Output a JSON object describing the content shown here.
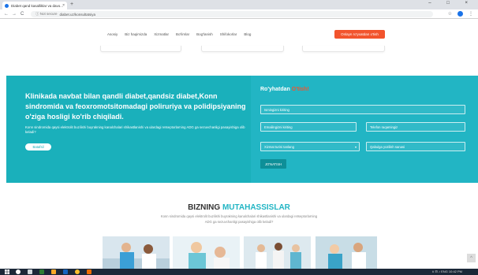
{
  "browser": {
    "tab_title": "Diabet qand kasalliklar va davo...",
    "tab_close": "×",
    "new_tab": "+",
    "window_controls": "– □ ×",
    "back": "←",
    "forward": "→",
    "reload": "C",
    "security": "ⓘ Not secure",
    "url": "diabet.uz/konsultatsiya",
    "toolbar_icons": [
      "☆",
      "⋮"
    ]
  },
  "nav": {
    "items": [
      "Asosiy",
      "Biz haqimizda",
      "Xizmatlar",
      "Bo'limlar",
      "Bog'lanish",
      "Shifokorlar",
      "Blog"
    ],
    "cta": "Onlayn ro'yxatdan o'tish"
  },
  "hero": {
    "title": "Klinikada navbat bilan qandli diabet,qandsiz diabet,Konn sindromida va feoxromotsitomadagi poliruriya va polidipsiyaning o'ziga hosligi ko'rib chiqiladi.",
    "subtitle": "Konn sindromida qaysi elektrolit buzilishi buyrakning kanalchalari shikastlanishi va ulardagi retseptorlarning ADG ga sezuvchanligi pasayishiga olib keladi?",
    "button": "Batafsil"
  },
  "form": {
    "title_main": "Ro'yhatdan ",
    "title_accent": "O'tish!",
    "fields": {
      "name_placeholder": "Ismingizni kiriting",
      "phone_placeholder": "Telefon raqamingiz",
      "email_placeholder": "Emailingizni kiriting",
      "service_select": "Xizmat turini tanlang",
      "date_placeholder": "Qabulga yozilish sanasi"
    },
    "select_caret": "▾",
    "submit": "JO'NATISH"
  },
  "specialists": {
    "title_main": "BIZNING ",
    "title_accent": "MUTAHASSISLAR",
    "subtitle": "Konn sindromida qaysi elektrolit buzilishi buyrakning kanalchalari shikastlanishi va ulardagi retseptorlarning ADG ga sezuvchanligi pasayishiga olib keladi?"
  },
  "scroll_top": "^",
  "taskbar": {
    "tray": "∧  ⊟  ♪  ENG  10:42 PM"
  },
  "colors": {
    "accent": "#f2542d",
    "teal": "#22b5c4",
    "hero_teal": "#1ab0bb",
    "taskbar": "#1b2838"
  }
}
